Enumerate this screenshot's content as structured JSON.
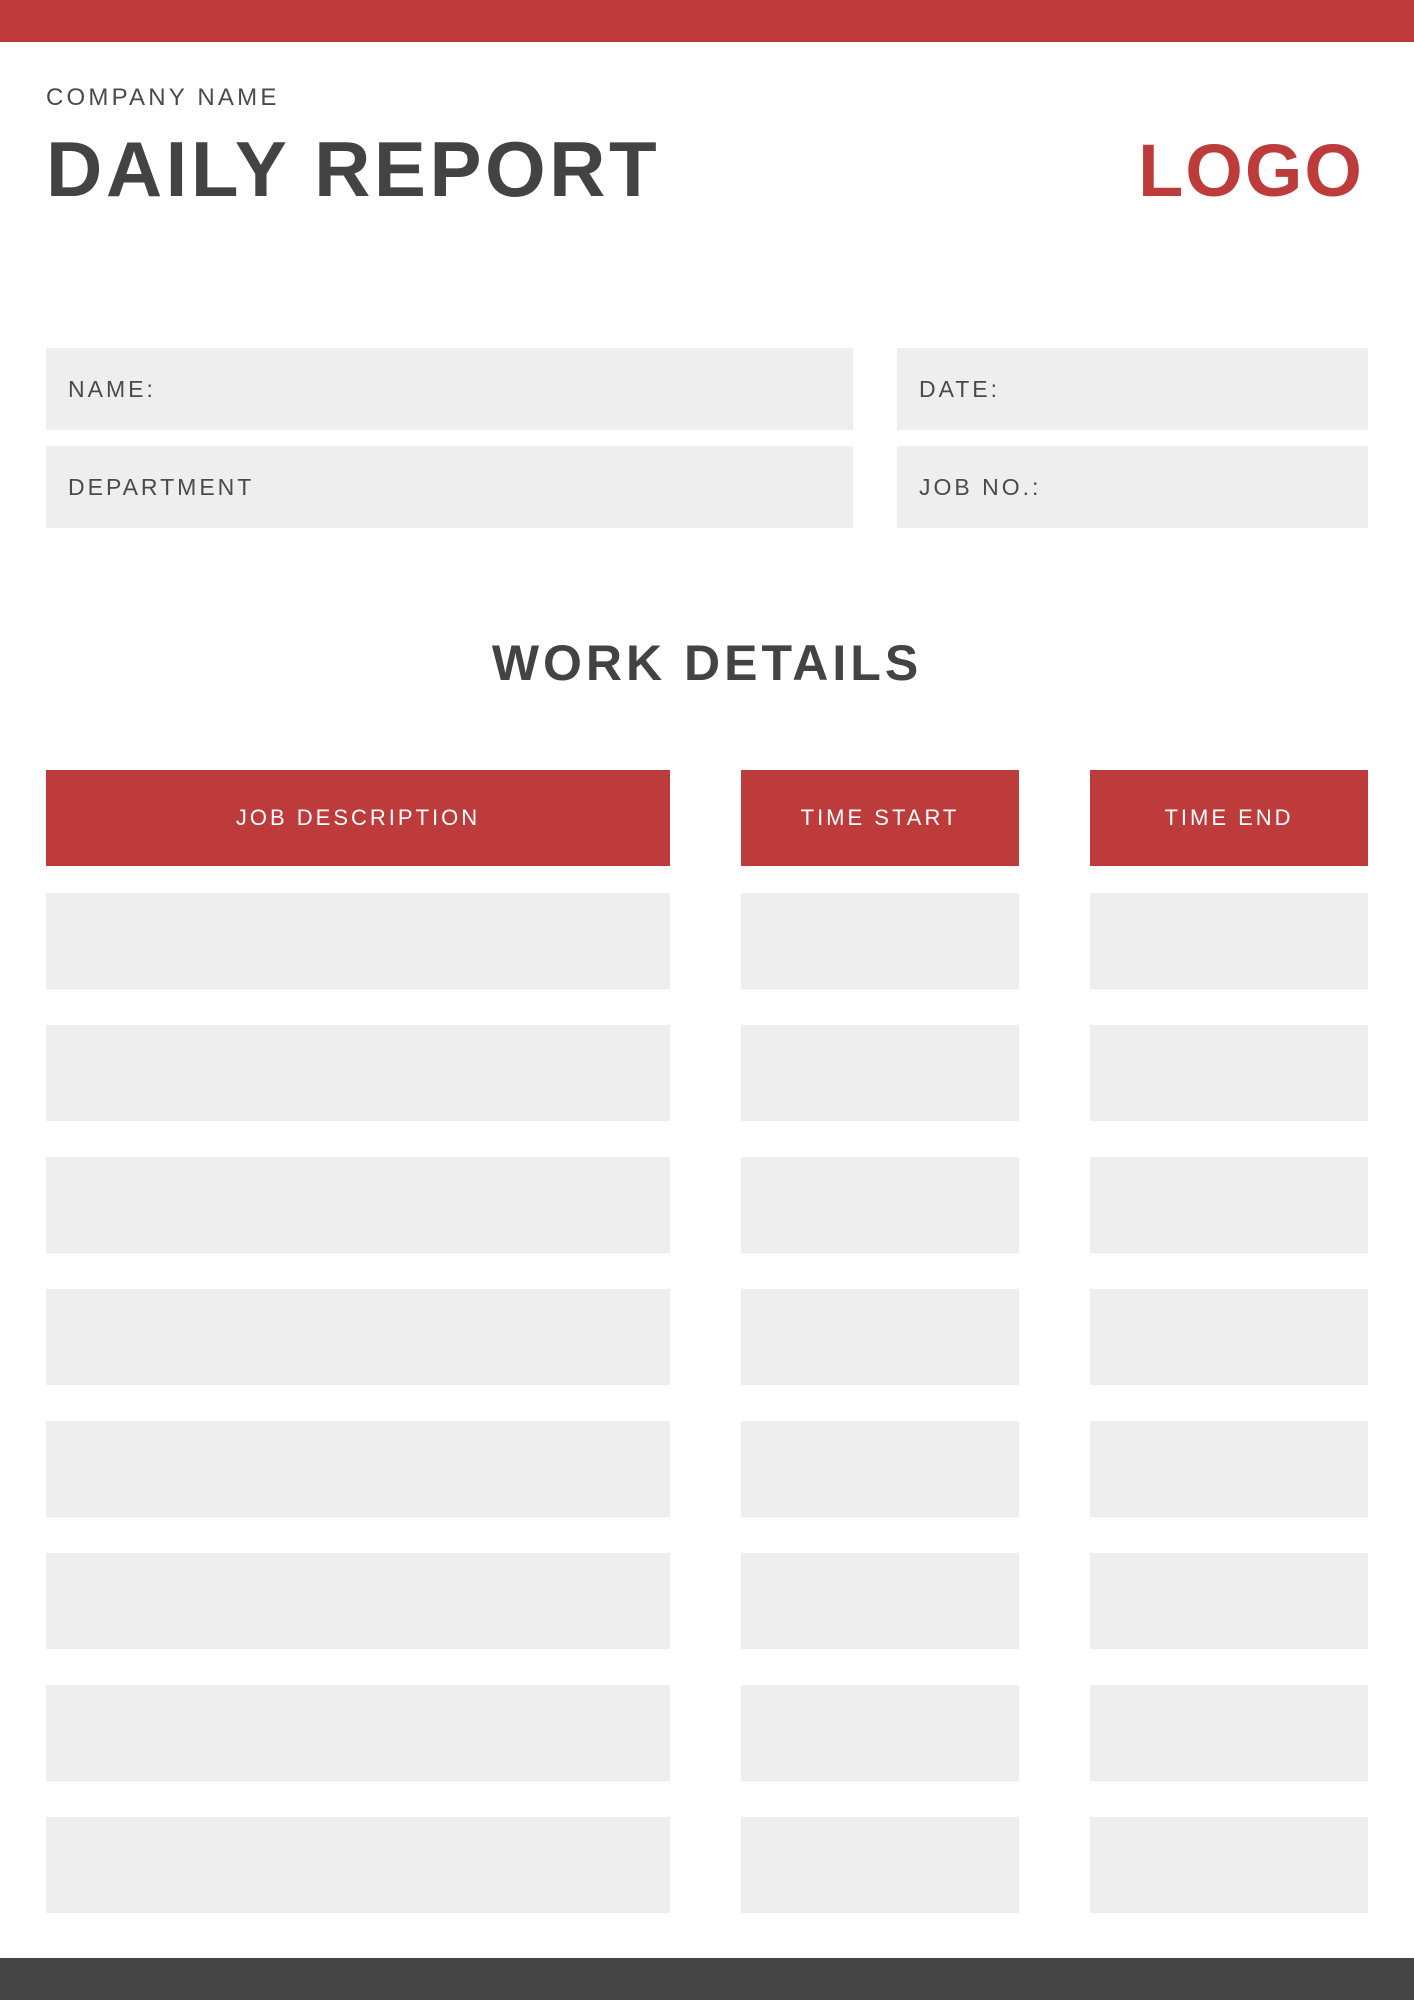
{
  "theme": {
    "accent_red": "#bd3b3b",
    "dark_gray": "#444444",
    "field_gray": "#eeeeee",
    "text_dark": "#434343"
  },
  "header": {
    "company_name": "COMPANY NAME",
    "title": "DAILY REPORT",
    "logo": "LOGO"
  },
  "fields": {
    "name_label": "NAME:",
    "date_label": "DATE:",
    "department_label": "DEPARTMENT",
    "job_no_label": "JOB NO.:"
  },
  "work_details": {
    "heading": "WORK DETAILS",
    "columns": [
      {
        "label": "JOB DESCRIPTION"
      },
      {
        "label": "TIME START"
      },
      {
        "label": "TIME END"
      }
    ],
    "rows": [
      {
        "job_description": "",
        "time_start": "",
        "time_end": ""
      },
      {
        "job_description": "",
        "time_start": "",
        "time_end": ""
      },
      {
        "job_description": "",
        "time_start": "",
        "time_end": ""
      },
      {
        "job_description": "",
        "time_start": "",
        "time_end": ""
      },
      {
        "job_description": "",
        "time_start": "",
        "time_end": ""
      },
      {
        "job_description": "",
        "time_start": "",
        "time_end": ""
      },
      {
        "job_description": "",
        "time_start": "",
        "time_end": ""
      },
      {
        "job_description": "",
        "time_start": "",
        "time_end": ""
      }
    ]
  }
}
